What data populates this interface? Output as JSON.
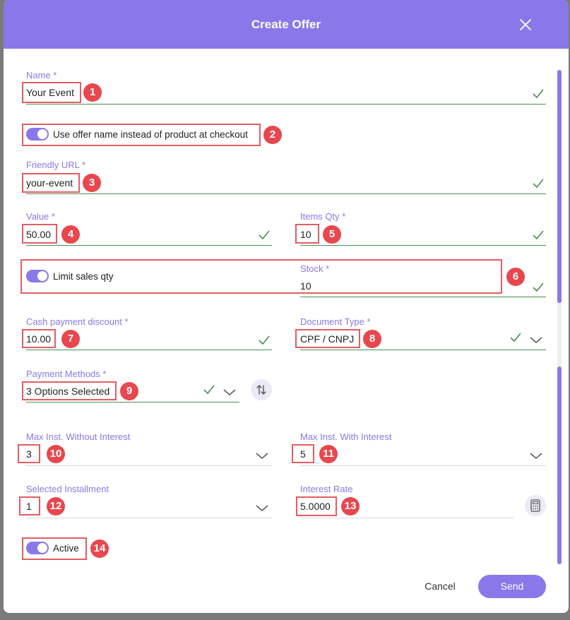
{
  "dialog": {
    "title": "Create Offer"
  },
  "form": {
    "name": {
      "label": "Name *",
      "value": "Your Event"
    },
    "use_offer_name": {
      "label": "Use offer name instead of product at checkout",
      "enabled": true
    },
    "friendly_url": {
      "label": "Friendly URL *",
      "value": "your-event"
    },
    "value": {
      "label": "Value *",
      "value": "50.00"
    },
    "items_qty": {
      "label": "Items Qty *",
      "value": "10"
    },
    "limit_sales": {
      "label": "Limit sales qty",
      "enabled": true
    },
    "stock": {
      "label": "Stock *",
      "value": "10"
    },
    "cash_discount": {
      "label": "Cash payment discount *",
      "value": "10.00"
    },
    "document_type": {
      "label": "Document Type *",
      "value": "CPF / CNPJ"
    },
    "payment_methods": {
      "label": "Payment Methods *",
      "value": "3 Options Selected"
    },
    "max_inst_without": {
      "label": "Max Inst. Without Interest",
      "value": "3"
    },
    "max_inst_with": {
      "label": "Max Inst. With Interest",
      "value": "5"
    },
    "selected_installment": {
      "label": "Selected Installment",
      "value": "1"
    },
    "interest_rate": {
      "label": "Interest Rate",
      "value": "5.0000"
    },
    "active": {
      "label": "Active",
      "enabled": true
    }
  },
  "annotations": [
    "1",
    "2",
    "3",
    "4",
    "5",
    "6",
    "7",
    "8",
    "9",
    "10",
    "11",
    "12",
    "13",
    "14"
  ],
  "actions": {
    "cancel": "Cancel",
    "send": "Send"
  },
  "icons": {
    "close": "close-icon",
    "check": "check-icon",
    "chevron": "chevron-down-icon",
    "sort": "sort-arrows-icon",
    "calculator": "calculator-icon"
  },
  "colors": {
    "accent": "#8a78ea",
    "valid": "#4b8f52",
    "annotation": "#e8474e"
  }
}
